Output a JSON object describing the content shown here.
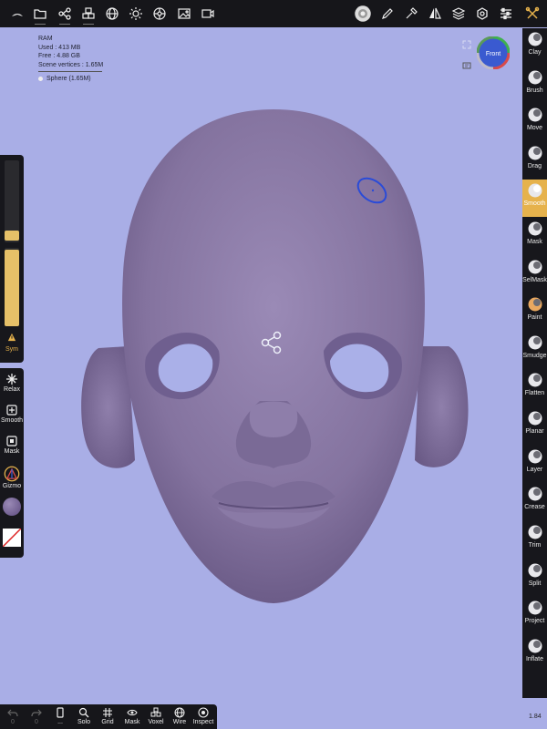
{
  "stats": {
    "ram_label": "RAM",
    "used": "Used :  413 MB",
    "free": "Free :  4.88 GB",
    "vertices": "Scene vertices :  1.65M",
    "object": "Sphere (1.65M)"
  },
  "nav": {
    "view": "Front"
  },
  "top_icons": [
    "nomad-logo-icon",
    "folder-icon",
    "scene-graph-icon",
    "cubes-icon",
    "globe-icon",
    "sun-icon",
    "material-icon",
    "image-icon",
    "video-icon",
    "brush-preview-icon",
    "pencil-icon",
    "dropper-icon",
    "symmetry-icon",
    "layers-icon",
    "settings-icon",
    "sliders-icon",
    "tools-icon"
  ],
  "right_tools": [
    {
      "label": "Clay",
      "icon": "clay-icon",
      "active": false
    },
    {
      "label": "Brush",
      "icon": "brush-icon",
      "active": false
    },
    {
      "label": "Move",
      "icon": "move-icon",
      "active": false
    },
    {
      "label": "Drag",
      "icon": "drag-icon",
      "active": false
    },
    {
      "label": "Smooth",
      "icon": "smooth-icon",
      "active": true
    },
    {
      "label": "Mask",
      "icon": "mask-icon",
      "active": false
    },
    {
      "label": "SelMask",
      "icon": "selmask-icon",
      "active": false
    },
    {
      "label": "Paint",
      "icon": "paint-icon",
      "active": false
    },
    {
      "label": "Smudge",
      "icon": "smudge-icon",
      "active": false
    },
    {
      "label": "Flatten",
      "icon": "flatten-icon",
      "active": false
    },
    {
      "label": "Planar",
      "icon": "planar-icon",
      "active": false
    },
    {
      "label": "Layer",
      "icon": "layer-icon",
      "active": false
    },
    {
      "label": "Crease",
      "icon": "crease-icon",
      "active": false
    },
    {
      "label": "Trim",
      "icon": "trim-icon",
      "active": false
    },
    {
      "label": "Split",
      "icon": "split-icon",
      "active": false
    },
    {
      "label": "Project",
      "icon": "project-icon",
      "active": false
    },
    {
      "label": "Inflate",
      "icon": "inflate-icon",
      "active": false
    }
  ],
  "left": {
    "sym": "Sym",
    "relax": "Relax",
    "smooth": "Smooth",
    "mask": "Mask",
    "gizmo": "Gizmo"
  },
  "bottom": {
    "undo": "0",
    "redo": "0",
    "more": "...",
    "solo": "Solo",
    "grid": "Grid",
    "mask": "Mask",
    "voxel": "Voxel",
    "wire": "Wire",
    "inspect": "Inspect"
  },
  "zoom": "1.84",
  "colors": {
    "accent": "#e6b24c",
    "background": "#a9aee6",
    "panel": "#17171c",
    "model": "#8a7aa6"
  }
}
